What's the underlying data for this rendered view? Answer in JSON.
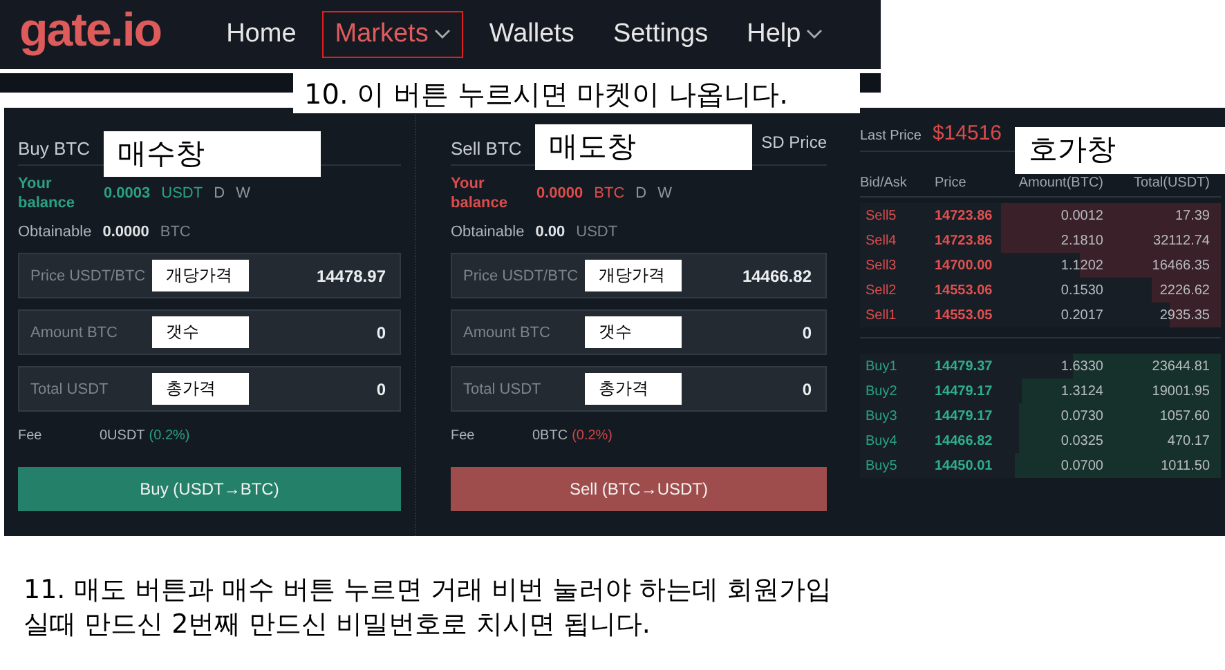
{
  "nav": {
    "logo": "gate.io",
    "items": [
      {
        "label": "Home",
        "selected": false,
        "dropdown": false
      },
      {
        "label": "Markets",
        "selected": true,
        "dropdown": true
      },
      {
        "label": "Wallets",
        "selected": false,
        "dropdown": false
      },
      {
        "label": "Settings",
        "selected": false,
        "dropdown": false
      },
      {
        "label": "Help",
        "selected": false,
        "dropdown": true
      }
    ]
  },
  "nav_callout": "10. 이 버튼 누르시면 마켓이 나옵니다.",
  "panels": [
    {
      "kind": "buy",
      "title": "Buy BTC",
      "callout": "매수창",
      "balance_label": "Your balance",
      "balance_value": "0.0003",
      "balance_unit": "USDT",
      "deposit": "D",
      "withdraw": "W",
      "obtainable_label": "Obtainable",
      "obtainable_value": "0.0000",
      "obtainable_unit": "BTC",
      "fields": [
        {
          "label": "Price USDT/BTC",
          "callout": "개당가격",
          "value": "14478.97"
        },
        {
          "label": "Amount BTC",
          "callout": "갯수",
          "value": "0"
        },
        {
          "label": "Total USDT",
          "callout": "총가격",
          "value": "0"
        }
      ],
      "fee_label": "Fee",
      "fee_value": "0USDT",
      "fee_rate": "(0.2%)",
      "button": "Buy (USDT→BTC)"
    },
    {
      "kind": "sell",
      "title": "Sell BTC",
      "callout": "매도창",
      "tab": "SD Price",
      "balance_label": "Your balance",
      "balance_value": "0.0000",
      "balance_unit": "BTC",
      "deposit": "D",
      "withdraw": "W",
      "obtainable_label": "Obtainable",
      "obtainable_value": "0.00",
      "obtainable_unit": "USDT",
      "fields": [
        {
          "label": "Price USDT/BTC",
          "callout": "개당가격",
          "value": "14466.82"
        },
        {
          "label": "Amount BTC",
          "callout": "갯수",
          "value": "0"
        },
        {
          "label": "Total USDT",
          "callout": "총가격",
          "value": "0"
        }
      ],
      "fee_label": "Fee",
      "fee_value": "0BTC",
      "fee_rate": "(0.2%)",
      "button": "Sell (BTC→USDT)"
    }
  ],
  "order_book": {
    "last_price_label": "Last Price",
    "last_price": "$14516",
    "callout": "호가창",
    "columns": [
      "Bid/Ask",
      "Price",
      "Amount(BTC)",
      "Total(USDT)"
    ],
    "asks": [
      {
        "name": "Sell5",
        "price": "14723.86",
        "amount": "0.0012",
        "total": "17.39",
        "level": 0.61
      },
      {
        "name": "Sell4",
        "price": "14723.86",
        "amount": "2.1810",
        "total": "32112.74",
        "level": 0.61
      },
      {
        "name": "Sell3",
        "price": "14700.00",
        "amount": "1.1202",
        "total": "16466.35",
        "level": 0.39
      },
      {
        "name": "Sell2",
        "price": "14553.06",
        "amount": "0.1530",
        "total": "2226.62",
        "level": 0.19
      },
      {
        "name": "Sell1",
        "price": "14553.05",
        "amount": "0.2017",
        "total": "2935.35",
        "level": 0.14
      }
    ],
    "bids": [
      {
        "name": "Buy1",
        "price": "14479.37",
        "amount": "1.6330",
        "total": "23644.81",
        "level": 0.41
      },
      {
        "name": "Buy2",
        "price": "14479.17",
        "amount": "1.3124",
        "total": "19001.95",
        "level": 0.55
      },
      {
        "name": "Buy3",
        "price": "14479.17",
        "amount": "0.0730",
        "total": "1057.60",
        "level": 0.56
      },
      {
        "name": "Buy4",
        "price": "14466.82",
        "amount": "0.0325",
        "total": "470.17",
        "level": 0.56
      },
      {
        "name": "Buy5",
        "price": "14450.01",
        "amount": "0.0700",
        "total": "1011.50",
        "level": 0.57
      }
    ]
  },
  "footer_note": [
    "11. 매도 버튼과 매수 버튼 누르면 거래 비번 눌러야 하는데 회원가입",
    "실때 만드신 2번째 만드신 비밀번호로 치시면 됩니다."
  ]
}
